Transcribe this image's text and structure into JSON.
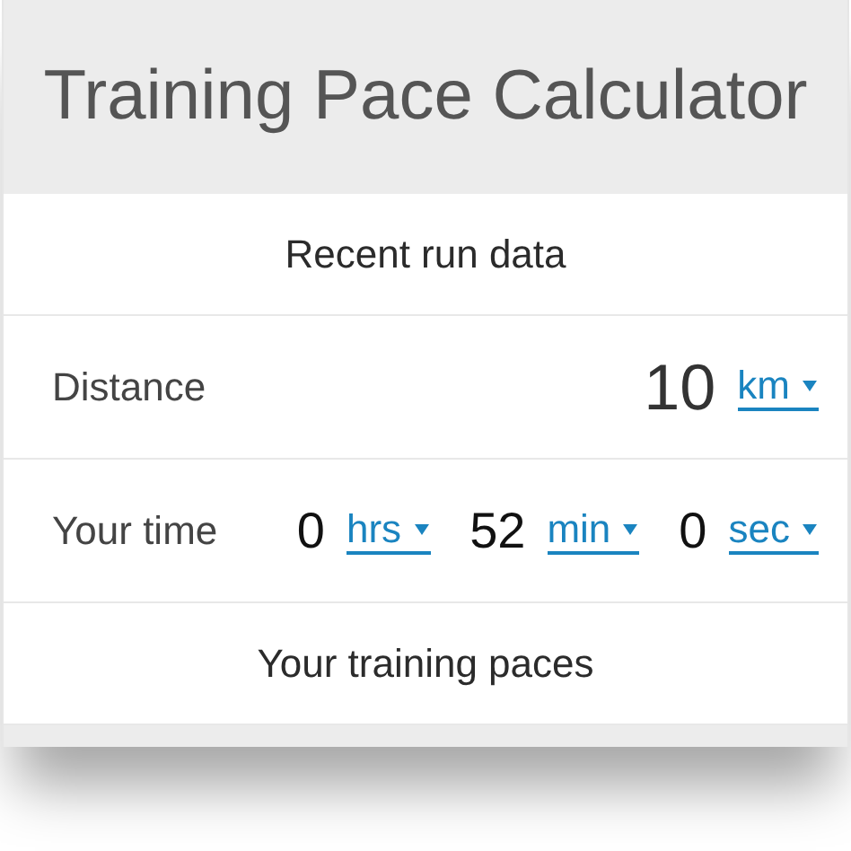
{
  "title": "Training Pace Calculator",
  "sections": [
    {
      "kind": "heading",
      "text": "Recent run data"
    },
    {
      "kind": "row",
      "label": "Distance",
      "fields": [
        {
          "value": "10",
          "unit": "km"
        }
      ]
    },
    {
      "kind": "row",
      "label": "Your time",
      "fields": [
        {
          "value": "0",
          "unit": "hrs"
        },
        {
          "value": "52",
          "unit": "min"
        },
        {
          "value": "0",
          "unit": "sec"
        }
      ]
    },
    {
      "kind": "heading",
      "text": "Your training paces"
    }
  ]
}
